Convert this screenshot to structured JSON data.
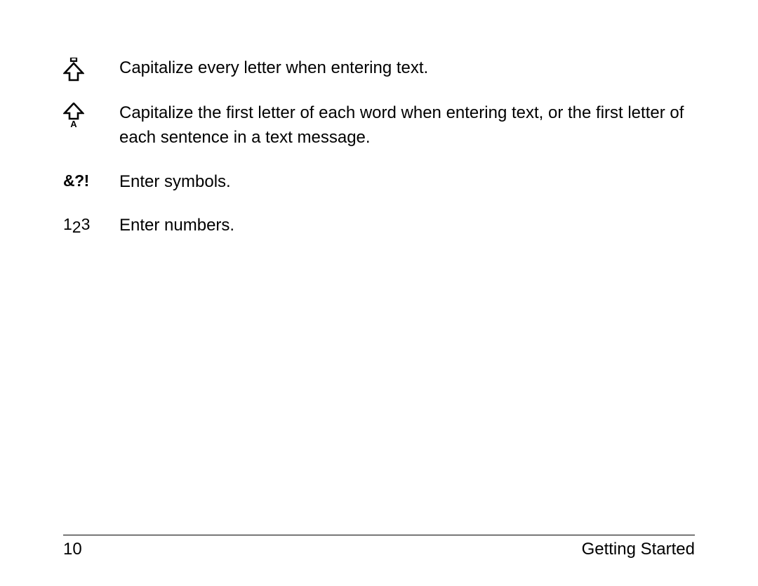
{
  "rows": [
    {
      "id": "caps-lock",
      "desc": "Capitalize every letter when entering text."
    },
    {
      "id": "shift",
      "desc": "Capitalize the first letter of each word when entering text, or the first letter of each sentence in a text message."
    },
    {
      "id": "symbols",
      "desc": "Enter symbols.",
      "icon_label": "&?!"
    },
    {
      "id": "numbers",
      "desc": "Enter numbers.",
      "icon_label": "123"
    }
  ],
  "footer": {
    "page_number": "10",
    "section": "Getting Started"
  }
}
